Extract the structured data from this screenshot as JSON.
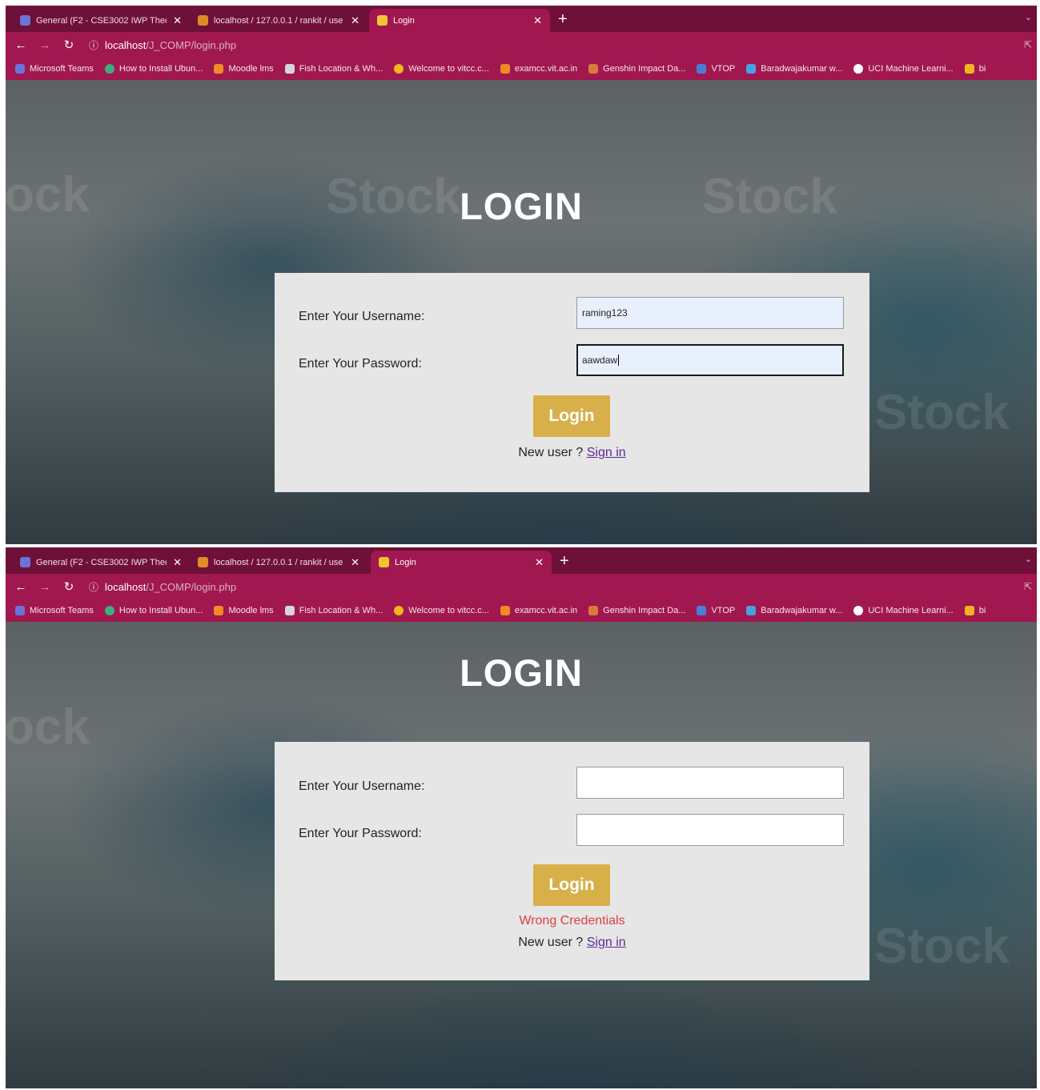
{
  "browser": {
    "tabs": [
      {
        "label": "General (F2 - CSE3002 IWP Theo",
        "icon": "teams-icon",
        "icon_color": "#6b73d8"
      },
      {
        "label": "localhost / 127.0.0.1 / rankit / use",
        "icon": "phpmyadmin-icon",
        "icon_color": "#e08a28"
      },
      {
        "label": "Login",
        "icon": "page-icon",
        "icon_color": "#f2c432"
      }
    ],
    "new_tab": "+",
    "url_host": "localhost",
    "url_path": "/J_COMP/login.php",
    "bookmarks": [
      {
        "label": "Microsoft Teams",
        "icon_color": "#6b73d8"
      },
      {
        "label": "How to Install Ubun...",
        "icon_color": "#3bb07a"
      },
      {
        "label": "Moodle lms",
        "icon_color": "#f08a24"
      },
      {
        "label": "Fish Location & Wh...",
        "icon_color": "#d7d7d7"
      },
      {
        "label": "Welcome to vitcc.c...",
        "icon_color": "#f2b51d"
      },
      {
        "label": "examcc.vit.ac.in",
        "icon_color": "#f08a24"
      },
      {
        "label": "Genshin Impact Da...",
        "icon_color": "#d87a3a"
      },
      {
        "label": "VTOP",
        "icon_color": "#4a7dd8"
      },
      {
        "label": "Baradwajakumar w...",
        "icon_color": "#4aa0e0"
      },
      {
        "label": "UCI Machine Learni...",
        "icon_color": "#ffffff"
      },
      {
        "label": "bi",
        "icon_color": "#f2b51d"
      }
    ]
  },
  "page": {
    "title": "LOGIN",
    "username_label": "Enter Your Username:",
    "password_label": "Enter Your Password:",
    "login_button": "Login",
    "new_user_text": "New user ? ",
    "sign_in_link": "Sign in",
    "watermark": "Stock",
    "watermark_partial": "ock"
  },
  "state1": {
    "username_value": "raming123",
    "password_value": "aawdaw"
  },
  "state2": {
    "username_value": "",
    "password_value": "",
    "error": "Wrong Credentials"
  }
}
